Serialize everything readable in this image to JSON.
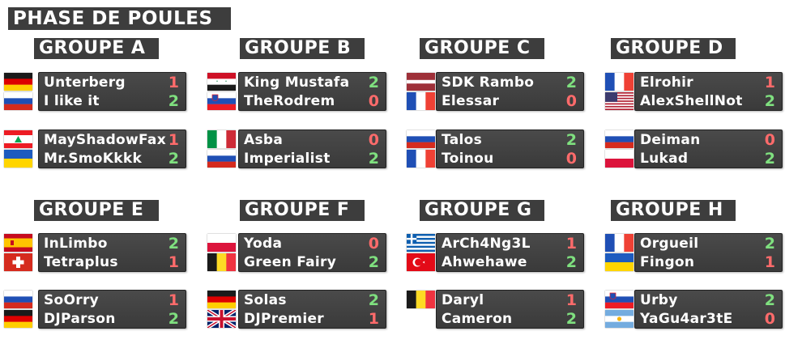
{
  "title": "PHASE DE POULES",
  "groups": [
    {
      "label": "GROUPE A",
      "matches": [
        {
          "p1": {
            "name": "Unterberg",
            "flag": "germany",
            "score": "1"
          },
          "p2": {
            "name": "I like it",
            "flag": "russia",
            "score": "2"
          }
        },
        {
          "p1": {
            "name": "MayShadowFax",
            "flag": "lebanon",
            "score": "1"
          },
          "p2": {
            "name": "Mr.SmoKkkk",
            "flag": "ukraine",
            "score": "2"
          }
        }
      ]
    },
    {
      "label": "GROUPE B",
      "matches": [
        {
          "p1": {
            "name": "King Mustafa",
            "flag": "syria",
            "score": "2"
          },
          "p2": {
            "name": "TheRodrem",
            "flag": "slovenia",
            "score": "0"
          }
        },
        {
          "p1": {
            "name": "Asba",
            "flag": "italy",
            "score": "0"
          },
          "p2": {
            "name": "Imperialist",
            "flag": "russia",
            "score": "2"
          }
        }
      ]
    },
    {
      "label": "GROUPE C",
      "matches": [
        {
          "p1": {
            "name": "SDK Rambo",
            "flag": "latvia",
            "score": "2"
          },
          "p2": {
            "name": "Elessar",
            "flag": "france",
            "score": "0"
          }
        },
        {
          "p1": {
            "name": "Talos",
            "flag": "russia",
            "score": "2"
          },
          "p2": {
            "name": "Toinou",
            "flag": "france",
            "score": "0"
          }
        }
      ]
    },
    {
      "label": "GROUPE D",
      "matches": [
        {
          "p1": {
            "name": "Elrohir",
            "flag": "france",
            "score": "1"
          },
          "p2": {
            "name": "AlexShellNot",
            "flag": "usa",
            "score": "2"
          }
        },
        {
          "p1": {
            "name": "Deiman",
            "flag": "russia",
            "score": "0"
          },
          "p2": {
            "name": "Lukad",
            "flag": "poland",
            "score": "2"
          }
        }
      ]
    },
    {
      "label": "GROUPE E",
      "matches": [
        {
          "p1": {
            "name": "InLimbo",
            "flag": "spain",
            "score": "2"
          },
          "p2": {
            "name": "Tetraplus",
            "flag": "switzerland",
            "score": "1"
          }
        },
        {
          "p1": {
            "name": "SoOrry",
            "flag": "russia",
            "score": "1"
          },
          "p2": {
            "name": "DJParson",
            "flag": "germany",
            "score": "2"
          }
        }
      ]
    },
    {
      "label": "GROUPE F",
      "matches": [
        {
          "p1": {
            "name": "Yoda",
            "flag": "poland",
            "score": "0"
          },
          "p2": {
            "name": "Green Fairy",
            "flag": "belgium",
            "score": "2"
          }
        },
        {
          "p1": {
            "name": "Solas",
            "flag": "germany",
            "score": "2"
          },
          "p2": {
            "name": "DJPremier",
            "flag": "uk",
            "score": "1"
          }
        }
      ]
    },
    {
      "label": "GROUPE G",
      "matches": [
        {
          "p1": {
            "name": "ArCh4Ng3L",
            "flag": "greece",
            "score": "1"
          },
          "p2": {
            "name": "Ahwehawe",
            "flag": "turkey",
            "score": "2"
          }
        },
        {
          "p1": {
            "name": "Daryl",
            "flag": "belgium",
            "score": "1"
          },
          "p2": {
            "name": "Cameron",
            "flag": "",
            "score": "2"
          }
        }
      ]
    },
    {
      "label": "GROUPE H",
      "matches": [
        {
          "p1": {
            "name": "Orgueil",
            "flag": "france",
            "score": "2"
          },
          "p2": {
            "name": "Fingon",
            "flag": "ukraine",
            "score": "1"
          }
        },
        {
          "p1": {
            "name": "Urby",
            "flag": "slovenia",
            "score": "2"
          },
          "p2": {
            "name": "YaGu4ar3tE",
            "flag": "argentina",
            "score": "0"
          }
        }
      ]
    }
  ],
  "colors": {
    "panel": "#3d3d3d",
    "win": "#7fe07f",
    "lose": "#ff6b6b"
  }
}
